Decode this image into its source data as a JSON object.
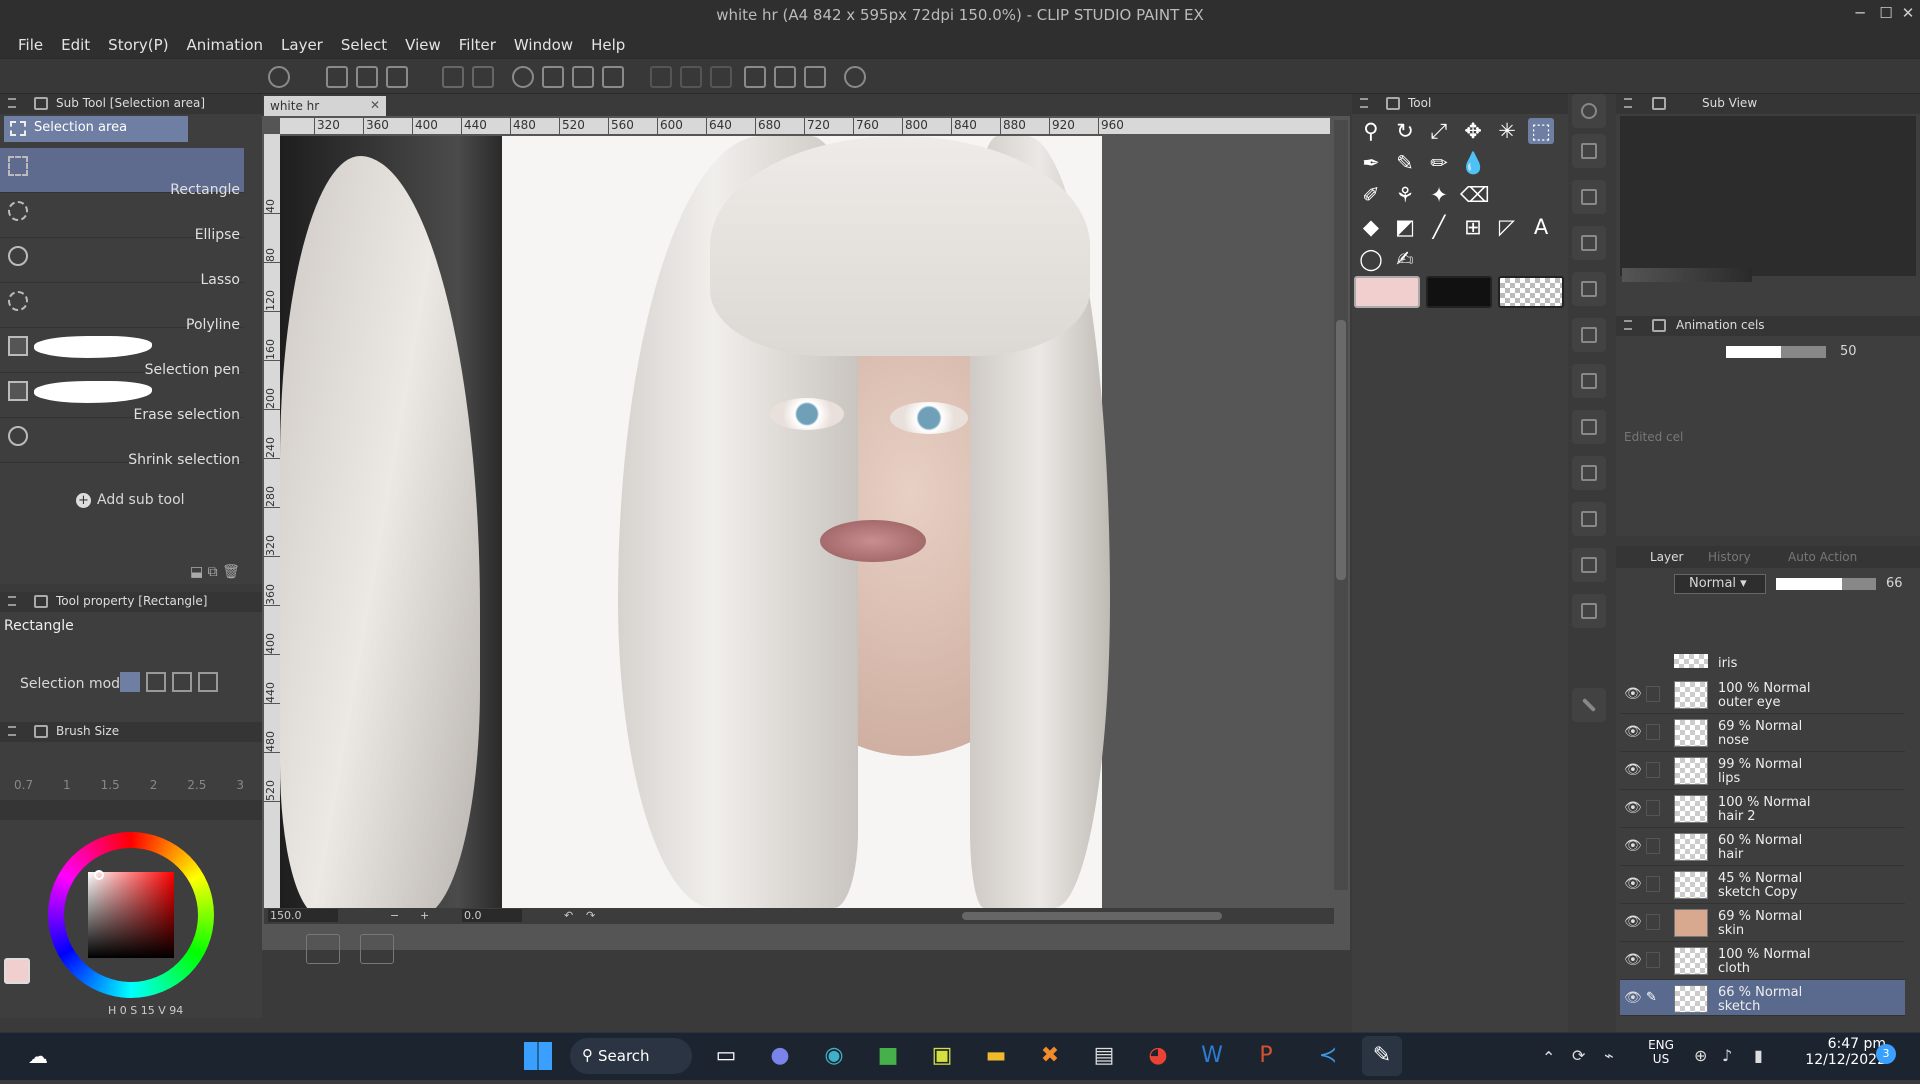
{
  "window": {
    "title": "white hr (A4 842 x 595px 72dpi 150.0%)  - CLIP STUDIO PAINT EX"
  },
  "menu": [
    "File",
    "Edit",
    "Story(P)",
    "Animation",
    "Layer",
    "Select",
    "View",
    "Filter",
    "Window",
    "Help"
  ],
  "subtool": {
    "header": "Sub Tool [Selection area]",
    "group": "Selection area",
    "items": [
      "Rectangle",
      "Ellipse",
      "Lasso",
      "Polyline",
      "Selection pen",
      "Erase selection",
      "Shrink selection"
    ],
    "add_label": "Add sub tool"
  },
  "toolprop": {
    "header": "Tool property [Rectangle]",
    "name": "Rectangle",
    "mode_label": "Selection mode"
  },
  "brushsize": {
    "header": "Brush Size",
    "values": [
      "0.7",
      "1",
      "1.5",
      "2",
      "2.5",
      "3"
    ]
  },
  "color": {
    "h_label": "H",
    "h": "0",
    "s_label": "S",
    "s": "15",
    "v_label": "V",
    "v": "94",
    "main": "#f2cfcf",
    "sub": "#1a1a1a"
  },
  "canvas": {
    "tab": "white hr",
    "zoom": "150.0",
    "angle": "0.0",
    "ruler_h": [
      "320",
      "360",
      "400",
      "440",
      "480",
      "520",
      "560",
      "600",
      "640",
      "680",
      "720",
      "760",
      "800",
      "840",
      "880",
      "920",
      "960"
    ],
    "ruler_v": [
      "40",
      "80",
      "120",
      "160",
      "200",
      "240",
      "280",
      "320",
      "360",
      "400",
      "440",
      "480",
      "520"
    ]
  },
  "toolpanel": {
    "header": "Tool"
  },
  "subview": {
    "header": "Sub View"
  },
  "animcels": {
    "header": "Animation cels",
    "opacity": "50",
    "cel": "Edited cel"
  },
  "layers": {
    "tabs": [
      "Layer",
      "History",
      "Auto Action"
    ],
    "blend": "Normal",
    "opacity": "66",
    "partial": "iris",
    "rows": [
      {
        "mode": "100 % Normal",
        "name": "outer eye"
      },
      {
        "mode": "69 % Normal",
        "name": "nose"
      },
      {
        "mode": "99 % Normal",
        "name": "lips"
      },
      {
        "mode": "100 % Normal",
        "name": "hair 2"
      },
      {
        "mode": "60 % Normal",
        "name": "hair"
      },
      {
        "mode": "45 % Normal",
        "name": "sketch Copy"
      },
      {
        "mode": "69 % Normal",
        "name": "skin"
      },
      {
        "mode": "100 % Normal",
        "name": "cloth"
      },
      {
        "mode": "66 % Normal",
        "name": "sketch"
      }
    ]
  },
  "taskbar": {
    "search": "Search",
    "lang1": "ENG",
    "lang2": "US",
    "time": "6:47 pm",
    "date": "12/12/2022",
    "badge": "3"
  }
}
